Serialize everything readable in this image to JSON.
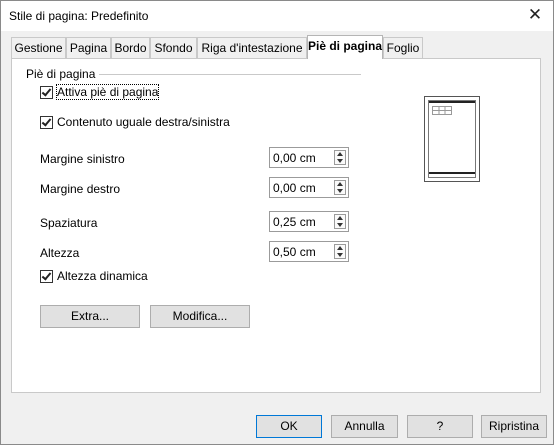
{
  "window": {
    "title": "Stile di pagina: Predefinito",
    "close_icon": "close-icon"
  },
  "tabs": [
    {
      "label": "Gestione"
    },
    {
      "label": "Pagina"
    },
    {
      "label": "Bordo"
    },
    {
      "label": "Sfondo"
    },
    {
      "label": "Riga d'intestazione"
    },
    {
      "label": "Piè di pagina",
      "active": true
    },
    {
      "label": "Foglio"
    }
  ],
  "footer": {
    "section_title": "Piè di pagina",
    "enable": {
      "label": "Attiva piè di pagina",
      "checked": true
    },
    "same_content": {
      "label": "Contenuto uguale destra/sinistra",
      "checked": true
    },
    "fields": [
      {
        "label": "Margine sinistro",
        "value": "0,00 cm"
      },
      {
        "label": "Margine destro",
        "value": "0,00 cm"
      },
      {
        "label": "Spaziatura",
        "value": "0,25 cm"
      },
      {
        "label": "Altezza",
        "value": "0,50 cm"
      }
    ],
    "dynamic_height": {
      "label": "Altezza dinamica",
      "checked": true
    },
    "extra_button": "Extra...",
    "edit_button": "Modifica..."
  },
  "buttons": {
    "ok": "OK",
    "cancel": "Annulla",
    "help": "?",
    "reset": "Ripristina"
  }
}
